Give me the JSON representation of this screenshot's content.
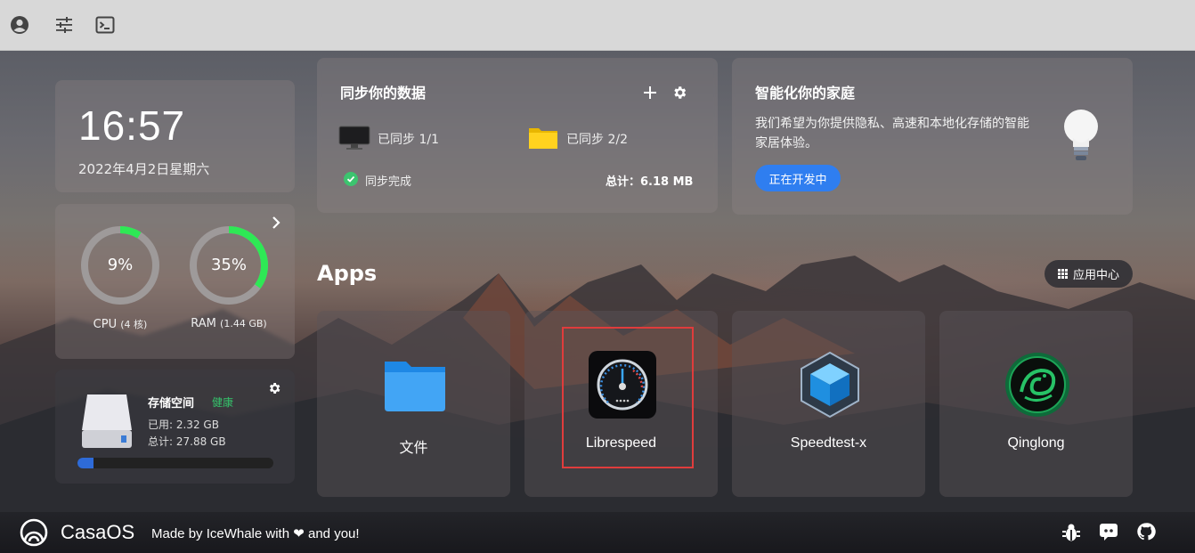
{
  "clock": {
    "time": "16:57",
    "date": "2022年4月2日星期六"
  },
  "system": {
    "cpu": {
      "value": "9%",
      "percent": 9,
      "label": "CPU",
      "detail": "(4 核)"
    },
    "ram": {
      "value": "35%",
      "percent": 35,
      "label": "RAM",
      "detail": "(1.44 GB)"
    }
  },
  "storage": {
    "title": "存储空间",
    "status": "健康",
    "used": "已用: 2.32 GB",
    "total": "总计: 27.88 GB",
    "used_percent": 8
  },
  "sync": {
    "title": "同步你的数据",
    "device_status": "已同步 1/1",
    "folder_status": "已同步 2/2",
    "complete": "同步完成",
    "total": "总计：6.18 MB"
  },
  "smart_home": {
    "title": "智能化你的家庭",
    "description": "我们希望为你提供隐私、高速和本地化存储的智能家居体验。",
    "button": "正在开发中"
  },
  "apps": {
    "title": "Apps",
    "app_center": "应用中心",
    "items": [
      {
        "name": "文件",
        "icon": "folder-icon"
      },
      {
        "name": "Librespeed",
        "icon": "speedometer-icon"
      },
      {
        "name": "Speedtest-x",
        "icon": "cube-icon"
      },
      {
        "name": "Qinglong",
        "icon": "dragon-emblem-icon"
      }
    ]
  },
  "footer": {
    "brand": "CasaOS",
    "made_by_prefix": "Made by IceWhale with",
    "made_by_suffix": "and you!"
  },
  "colors": {
    "accent_green": "#35c46b",
    "accent_blue": "#2f7ef0",
    "gauge_green": "#2ee855",
    "highlight_red": "#e03c3c"
  }
}
